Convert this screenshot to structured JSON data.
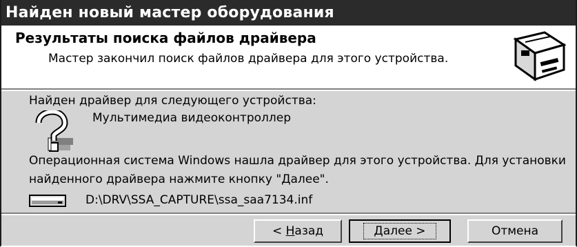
{
  "window": {
    "title": "Найден новый мастер оборудования"
  },
  "header": {
    "title": "Результаты поиска файлов драйвера",
    "subtitle": "Мастер закончил поиск файлов драйвера для этого устройства.",
    "icon": "hardware-wizard-icon"
  },
  "body": {
    "found_label": "Найден драйвер для следующего устройства:",
    "device_icon": "unknown-device-question-icon",
    "device_name": "Мультимедиа видеоконтроллер",
    "message": "Операционная система Windows нашла драйвер для этого устройства. Для установки найденного драйвера нажмите кнопку \"Далее\".",
    "file_icon": "drive-icon",
    "file_path": "D:\\DRV\\SSA_CAPTURE\\ssa_saa7134.inf"
  },
  "buttons": {
    "back_prefix": "< ",
    "back_accel": "Н",
    "back_rest": "азад",
    "next_accel": "Д",
    "next_rest": "алее >",
    "cancel": "Отмена"
  }
}
